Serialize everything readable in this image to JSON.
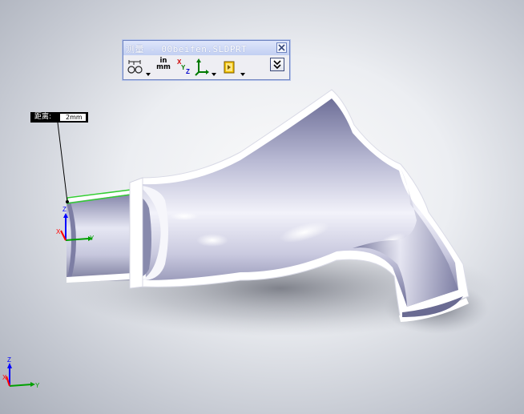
{
  "measure_window": {
    "title": "测量 - 00beifen.SLDPRT",
    "units_top": "in",
    "units_bottom": "mm",
    "tools": [
      {
        "name": "arc-circle-measurements",
        "has_dropdown": true
      },
      {
        "name": "units-precision",
        "has_dropdown": false
      },
      {
        "name": "show-xyz-measurements",
        "has_dropdown": false
      },
      {
        "name": "point-to-point",
        "has_dropdown": true
      },
      {
        "name": "measurement-history",
        "has_dropdown": true
      }
    ]
  },
  "callout": {
    "label": "距离:",
    "value": "2mm"
  },
  "triad": {
    "x_label": "X",
    "y_label": "Y",
    "z_label": "Z"
  },
  "colors": {
    "window_border": "#6f84c0",
    "titlebar": "#c2cff2",
    "selection_edge": "#33cc33",
    "axis_x": "#ff0000",
    "axis_y": "#00a000",
    "axis_z": "#0000ff",
    "part_shade": "#8e8fb2"
  }
}
